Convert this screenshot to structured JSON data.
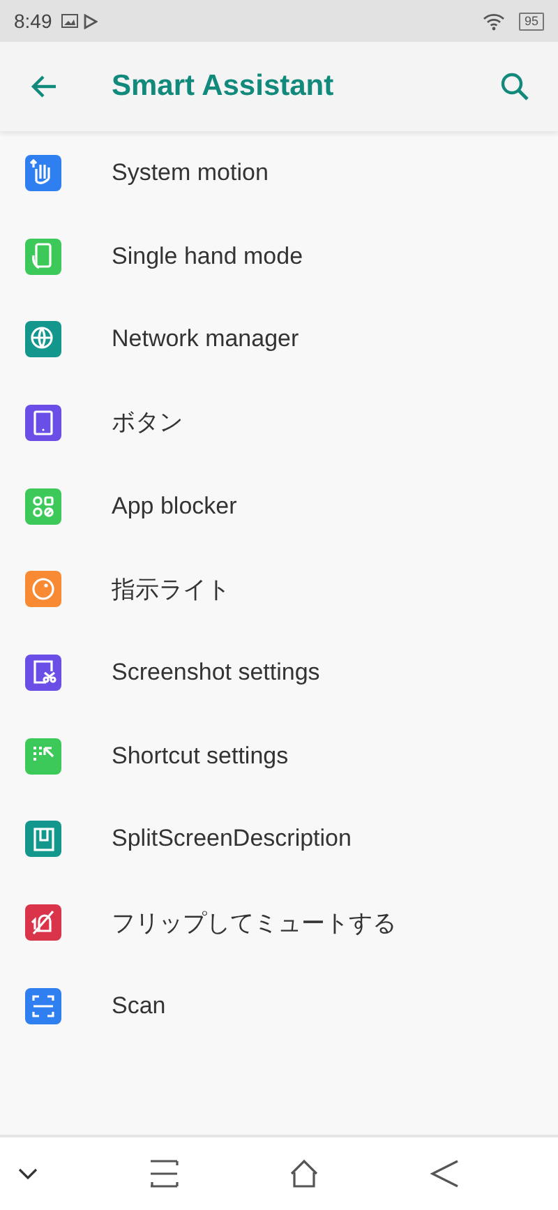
{
  "status_bar": {
    "time": "8:49",
    "battery": "95"
  },
  "app_bar": {
    "title": "Smart Assistant"
  },
  "items": [
    {
      "label": "System motion",
      "kind": "hand",
      "color": "#2f7ff0"
    },
    {
      "label": "Single hand mode",
      "kind": "phone-hand",
      "color": "#3cc95a"
    },
    {
      "label": "Network manager",
      "kind": "globe",
      "color": "#13968c"
    },
    {
      "label": "ボタン",
      "kind": "tablet",
      "color": "#6a4ee6"
    },
    {
      "label": "App blocker",
      "kind": "apps",
      "color": "#3cc95a"
    },
    {
      "label": "指示ライト",
      "kind": "circle",
      "color": "#f78a33"
    },
    {
      "label": "Screenshot settings",
      "kind": "scissors",
      "color": "#6a4ee6"
    },
    {
      "label": "Shortcut settings",
      "kind": "cursor",
      "color": "#3cc95a"
    },
    {
      "label": "SplitScreenDescription",
      "kind": "split",
      "color": "#13968c"
    },
    {
      "label": "フリップしてミュートする",
      "kind": "mute",
      "color": "#d9344a"
    },
    {
      "label": "Scan",
      "kind": "scan",
      "color": "#2f7ff0"
    }
  ]
}
